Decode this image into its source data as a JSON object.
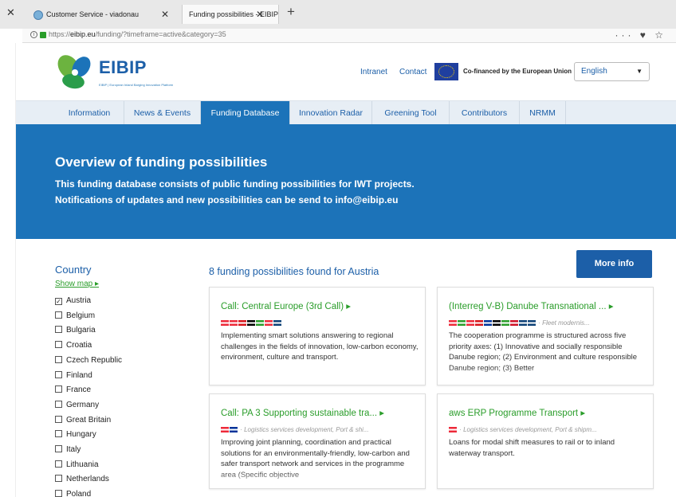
{
  "browser": {
    "tabs": [
      {
        "label": "Customer Service - viadonau",
        "close": "✕"
      },
      {
        "label": "Funding possibilities - EIBIP",
        "close": "✕"
      }
    ],
    "new_tab": "+",
    "url_prefix": "https://",
    "url_host": "eibip.eu",
    "url_path": "/funding/?timeframe=active&category=35",
    "url_icons": "··· ♥ ☆"
  },
  "header": {
    "logo_name": "EIBIP",
    "logo_sub": "EIBIP | European Inland Barging Innovation Platform",
    "links": [
      "Intranet",
      "Contact"
    ],
    "cofinanced": "Co-financed by the European Union",
    "language": "English"
  },
  "nav": {
    "items": [
      "Information",
      "News & Events",
      "Funding Database",
      "Innovation Radar",
      "Greening Tool",
      "Contributors",
      "NRMM"
    ],
    "active": "Funding Database"
  },
  "hero": {
    "title": "Overview of funding possibilities",
    "line1": "This funding database consists of public funding possibilities for IWT projects.",
    "line2": "Notifications of updates and new possibilities can be send to info@eibip.eu"
  },
  "sidebar": {
    "title": "Country",
    "show_map": "Show map ▸",
    "countries": [
      {
        "name": "Austria",
        "checked": true
      },
      {
        "name": "Belgium",
        "checked": false
      },
      {
        "name": "Bulgaria",
        "checked": false
      },
      {
        "name": "Croatia",
        "checked": false
      },
      {
        "name": "Czech Republic",
        "checked": false
      },
      {
        "name": "Finland",
        "checked": false
      },
      {
        "name": "France",
        "checked": false
      },
      {
        "name": "Germany",
        "checked": false
      },
      {
        "name": "Great Britain",
        "checked": false
      },
      {
        "name": "Hungary",
        "checked": false
      },
      {
        "name": "Italy",
        "checked": false
      },
      {
        "name": "Lithuania",
        "checked": false
      },
      {
        "name": "Netherlands",
        "checked": false
      },
      {
        "name": "Poland",
        "checked": false
      }
    ]
  },
  "results": {
    "title": "8 funding possibilities found for Austria",
    "more_info": "More info",
    "cards": [
      {
        "title": "Call: Central Europe (3rd Call) ▸",
        "flags": [
          "#ed2939",
          "#ed2939",
          "#d7141a",
          "#000000",
          "#2a9d2a",
          "#ed2939",
          "#0c4076"
        ],
        "tags": "",
        "description": "Implementing smart solutions answering to regional challenges in the fields of innovation, low-carbon economy, environment, culture and transport."
      },
      {
        "title": "(Interreg V-B) Danube Transnational ... ▸",
        "flags": [
          "#ed2939",
          "#2a9d2a",
          "#ed2939",
          "#d7141a",
          "#003399",
          "#000000",
          "#2a9d2a",
          "#ce1126",
          "#0c4076",
          "#0c4076"
        ],
        "tags": "· Fleet modernis...",
        "description": "The cooperation programme is structured across five priority axes: (1) Innovative and socially responsible Danube region; (2) Environment and culture responsible Danube region; (3) Better"
      },
      {
        "title": "Call: PA 3 Supporting sustainable tra... ▸",
        "flags": [
          "#ed2939",
          "#003399"
        ],
        "tags": "· Logistics services development, Port & shi...",
        "description": "Improving joint planning, coordination and practical solutions for an environmentally-friendly, low-carbon and safer transport network and services in the programme area (Specific objective"
      },
      {
        "title": "aws ERP Programme Transport ▸",
        "flags": [
          "#ed2939"
        ],
        "tags": "· Logistics services development, Port & shipm...",
        "description": "Loans for modal shift measures to rail or to inland waterway transport."
      }
    ]
  }
}
